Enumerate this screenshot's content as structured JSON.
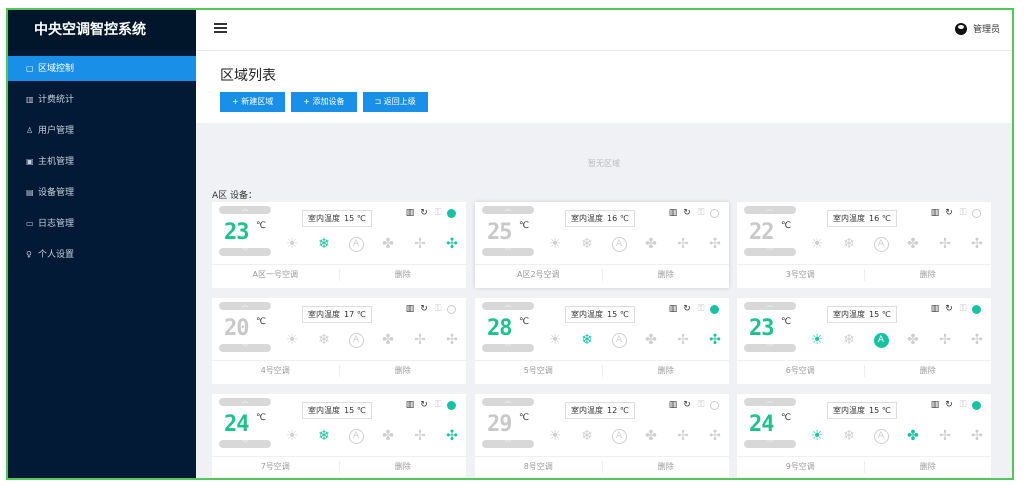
{
  "app": {
    "title": "中央空调智控系统"
  },
  "sidebar": {
    "items": [
      {
        "label": "区域控制",
        "icon": "folder-icon",
        "glyph": "▢",
        "active": true
      },
      {
        "label": "计费统计",
        "icon": "bar-chart-icon",
        "glyph": "▥",
        "active": false
      },
      {
        "label": "用户管理",
        "icon": "users-icon",
        "glyph": "♙",
        "active": false
      },
      {
        "label": "主机管理",
        "icon": "host-icon",
        "glyph": "▣",
        "active": false
      },
      {
        "label": "设备管理",
        "icon": "device-icon",
        "glyph": "▤",
        "active": false
      },
      {
        "label": "日志管理",
        "icon": "log-icon",
        "glyph": "▭",
        "active": false
      },
      {
        "label": "个人设置",
        "icon": "person-icon",
        "glyph": "♀",
        "active": false
      }
    ]
  },
  "header": {
    "user": "管理员"
  },
  "panel": {
    "title": "区域列表",
    "buttons": {
      "new_area": "+ 新建区域",
      "add_device": "+ 添加设备",
      "back": "⊐ 返回上级"
    }
  },
  "empty_text": "暂无区域",
  "section_label": "A区 设备：",
  "indoor_label": "室内温度",
  "delete_label": "删除",
  "unit": "℃",
  "cards": [
    {
      "name": "A区一号空调",
      "temp": "23",
      "indoor": "15 ℃",
      "on": true,
      "mode": "cool",
      "fan": true
    },
    {
      "name": "A区2号空调",
      "temp": "25",
      "indoor": "16 ℃",
      "on": false,
      "mode": "",
      "fan": false
    },
    {
      "name": "3号空调",
      "temp": "22",
      "indoor": "16 ℃",
      "on": false,
      "mode": "",
      "fan": false
    },
    {
      "name": "4号空调",
      "temp": "20",
      "indoor": "17 ℃",
      "on": false,
      "mode": "",
      "fan": false
    },
    {
      "name": "5号空调",
      "temp": "28",
      "indoor": "15 ℃",
      "on": true,
      "mode": "cool",
      "fan": true
    },
    {
      "name": "6号空调",
      "temp": "23",
      "indoor": "15 ℃",
      "on": true,
      "mode": "auto",
      "fan": false,
      "sun": true
    },
    {
      "name": "7号空调",
      "temp": "24",
      "indoor": "15 ℃",
      "on": true,
      "mode": "cool",
      "fan": true
    },
    {
      "name": "8号空调",
      "temp": "29",
      "indoor": "12 ℃",
      "on": false,
      "mode": "",
      "fan": false
    },
    {
      "name": "9号空调",
      "temp": "24",
      "indoor": "15 ℃",
      "on": true,
      "mode": "fan",
      "fan": false,
      "sun": true
    }
  ],
  "colors": {
    "accent": "#1a8fe8",
    "active_green": "#16c2a3",
    "sidebar": "#021a35",
    "frame": "#52c85a"
  }
}
